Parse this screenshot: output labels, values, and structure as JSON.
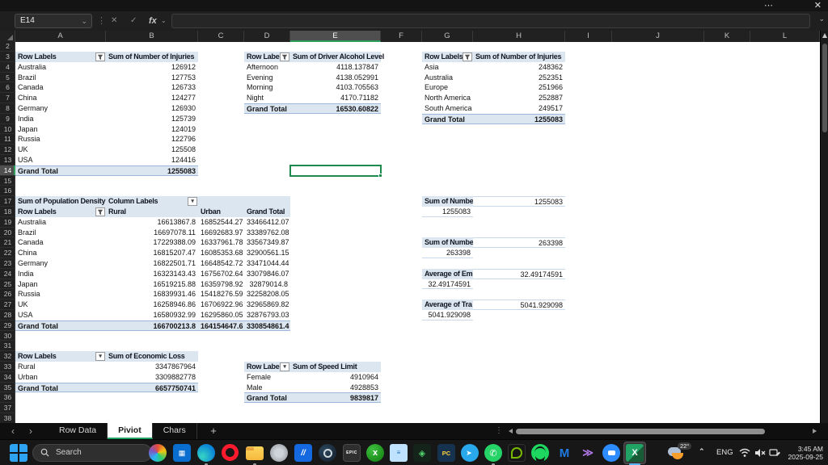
{
  "window": {
    "title_hidden": ""
  },
  "glyphs": {
    "more": "⋯",
    "close": "✕",
    "chevron_down": "⌄",
    "kebab": "⋮",
    "cancel": "✕",
    "enter": "✓",
    "fx": "fx",
    "prev": "‹",
    "next": "›",
    "chevron_up": "⌃"
  },
  "formula_bar": {
    "name_box": "E14",
    "formula_value": ""
  },
  "grid": {
    "columns": [
      "A",
      "B",
      "C",
      "D",
      "E",
      "F",
      "G",
      "H",
      "I",
      "J",
      "K",
      "L"
    ],
    "selected_column": "E",
    "row_start": 2,
    "row_end": 38,
    "selected_row": 14,
    "selected_cell": "E14"
  },
  "pivots": {
    "injuries_by_country": {
      "col1": "Row Labels",
      "col2": "Sum of Number of Injuries",
      "filter": "funnel",
      "rows": [
        [
          "Australia",
          "126912"
        ],
        [
          "Brazil",
          "127753"
        ],
        [
          "Canada",
          "126733"
        ],
        [
          "China",
          "124277"
        ],
        [
          "Germany",
          "126930"
        ],
        [
          "India",
          "125739"
        ],
        [
          "Japan",
          "124019"
        ],
        [
          "Russia",
          "122796"
        ],
        [
          "UK",
          "125508"
        ],
        [
          "USA",
          "124416"
        ]
      ],
      "grand_total": [
        "Grand Total",
        "1255083"
      ]
    },
    "alcohol_by_time": {
      "col1": "Row Labels",
      "col2": "Sum of Driver Alcohol Level",
      "filter": "funnel",
      "rows": [
        [
          "Afternoon",
          "4118.137847"
        ],
        [
          "Evening",
          "4138.052991"
        ],
        [
          "Morning",
          "4103.705563"
        ],
        [
          "Night",
          "4170.71182"
        ]
      ],
      "grand_total": [
        "Grand Total",
        "16530.60822"
      ]
    },
    "injuries_by_region": {
      "col1": "Row Labels",
      "col2": "Sum of Number of Injuries",
      "filter": "funnel",
      "rows": [
        [
          "Asia",
          "248362"
        ],
        [
          "Australia",
          "252351"
        ],
        [
          "Europe",
          "251966"
        ],
        [
          "North America",
          "252887"
        ],
        [
          "South America",
          "249517"
        ]
      ],
      "grand_total": [
        "Grand Total",
        "1255083"
      ]
    },
    "population_density": {
      "title": "Sum of Population Density",
      "column_labels": "Column Labels",
      "row_labels": "Row Labels",
      "col_headers": [
        "Rural",
        "Urban",
        "Grand Total"
      ],
      "rows": [
        [
          "Australia",
          "16613867.8",
          "16852544.27",
          "33466412.07"
        ],
        [
          "Brazil",
          "16697078.11",
          "16692683.97",
          "33389762.08"
        ],
        [
          "Canada",
          "17229388.09",
          "16337961.78",
          "33567349.87"
        ],
        [
          "China",
          "16815207.47",
          "16085353.68",
          "32900561.15"
        ],
        [
          "Germany",
          "16822501.71",
          "16648542.72",
          "33471044.44"
        ],
        [
          "India",
          "16323143.43",
          "16756702.64",
          "33079846.07"
        ],
        [
          "Japan",
          "16519215.88",
          "16359798.92",
          "32879014.8"
        ],
        [
          "Russia",
          "16839931.46",
          "15418276.59",
          "32258208.05"
        ],
        [
          "UK",
          "16258946.86",
          "16706922.96",
          "32965869.82"
        ],
        [
          "USA",
          "16580932.99",
          "16295860.05",
          "32876793.03"
        ]
      ],
      "grand_total": [
        "Grand Total",
        "166700213.8",
        "164154647.6",
        "330854861.4"
      ]
    },
    "economic_loss": {
      "col1": "Row Labels",
      "col2": "Sum of Economic Loss",
      "filter": "dropdown",
      "rows": [
        [
          "Rural",
          "3347867964"
        ],
        [
          "Urban",
          "3309882778"
        ]
      ],
      "grand_total": [
        "Grand Total",
        "6657750741"
      ]
    },
    "speed_limit": {
      "col1": "Row Labels",
      "col2": "Sum of Speed Limit",
      "filter": "dropdown",
      "rows": [
        [
          "Female",
          "4910964"
        ],
        [
          "Male",
          "4928853"
        ]
      ],
      "grand_total": [
        "Grand Total",
        "9839817"
      ]
    }
  },
  "side_values": [
    {
      "header": "Sum of Numbe",
      "total": "1255083",
      "adjacent": "1255083"
    },
    {
      "header": "Sum of Numbe",
      "total": "263398",
      "adjacent": "263398"
    },
    {
      "header": "Average of Em",
      "total": "32.49174591",
      "adjacent": "32.49174591"
    },
    {
      "header": "Average of Tra",
      "total": "5041.929098",
      "adjacent": "5041.929098"
    }
  ],
  "sheet_bar": {
    "tabs": [
      "Row Data",
      "Piviot",
      "Chars"
    ],
    "active": "Piviot",
    "add": "+"
  },
  "taskbar": {
    "search_placeholder": "Search",
    "weather_temp": "22°",
    "language": "ENG",
    "time": "3:45 AM",
    "date": "2025-09-25",
    "accent_excel": "#21a366",
    "icons": [
      {
        "name": "photos"
      },
      {
        "name": "store",
        "glyph": "▦"
      },
      {
        "name": "edge",
        "dot": true
      },
      {
        "name": "opera"
      },
      {
        "name": "explorer",
        "dot": true
      },
      {
        "name": "gray-app"
      },
      {
        "name": "blue-slash-app",
        "glyph": "//"
      },
      {
        "name": "steam"
      },
      {
        "name": "epic",
        "glyph": "EPIC"
      },
      {
        "name": "xbox",
        "glyph": "x"
      },
      {
        "name": "notepad",
        "glyph": "≡"
      },
      {
        "name": "game-launcher",
        "glyph": "◈"
      },
      {
        "name": "pc-app",
        "glyph": "PC"
      },
      {
        "name": "telegram",
        "glyph": "➤"
      },
      {
        "name": "whatsapp",
        "glyph": "✆",
        "dot": true
      },
      {
        "name": "nvidia"
      },
      {
        "name": "spotify"
      },
      {
        "name": "malwarebytes",
        "glyph": "M"
      },
      {
        "name": "visual-studio",
        "glyph": "≫"
      },
      {
        "name": "zoom-app"
      },
      {
        "name": "excel",
        "glyph": "X",
        "active": true
      }
    ]
  }
}
